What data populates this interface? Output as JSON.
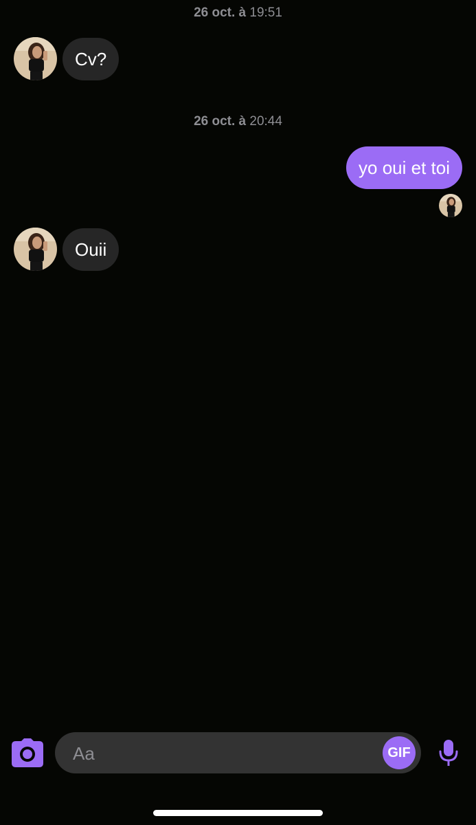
{
  "conversation": {
    "groups": [
      {
        "timestamp": {
          "date": "26 oct. à",
          "time": "19:51"
        },
        "messages": [
          {
            "direction": "incoming",
            "text": "Cv?"
          }
        ]
      },
      {
        "timestamp": {
          "date": "26 oct. à",
          "time": "20:44"
        },
        "messages": [
          {
            "direction": "outgoing",
            "text": "yo oui et toi",
            "read_receipt": true
          },
          {
            "direction": "incoming",
            "text": "Ouii"
          }
        ]
      }
    ]
  },
  "composer": {
    "placeholder": "Aa",
    "gif_label": "GIF"
  },
  "icons": {
    "camera": "camera-icon",
    "microphone": "microphone-icon"
  },
  "colors": {
    "background": "#050603",
    "accent": "#9b6cf5",
    "incoming_bubble": "#262626",
    "timestamp_text": "#8e8e93",
    "composer_background": "#333333"
  }
}
